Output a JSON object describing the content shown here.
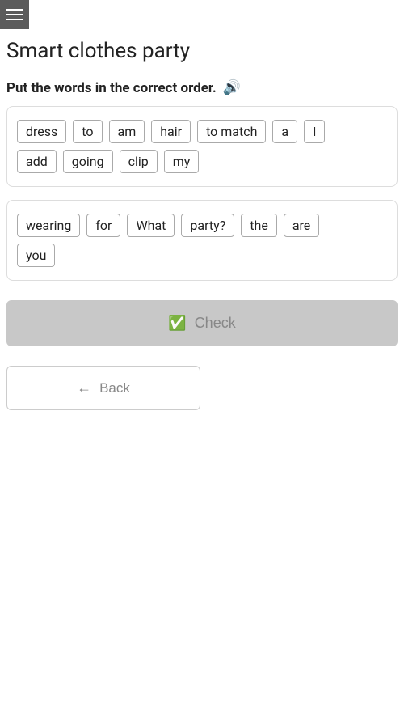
{
  "header": {
    "menu_label": "menu"
  },
  "page": {
    "title": "Smart clothes party",
    "instruction": "Put the words in the correct order.",
    "audio_label": "audio"
  },
  "word_groups": [
    {
      "id": "group1",
      "rows": [
        [
          "dress",
          "to",
          "am",
          "hair",
          "to match",
          "a",
          "I"
        ],
        [
          "add",
          "going",
          "clip",
          "my"
        ]
      ]
    },
    {
      "id": "group2",
      "rows": [
        [
          "wearing",
          "for",
          "What",
          "party?",
          "the",
          "are"
        ],
        [
          "you"
        ]
      ]
    }
  ],
  "buttons": {
    "check_label": "Check",
    "back_label": "Back"
  }
}
